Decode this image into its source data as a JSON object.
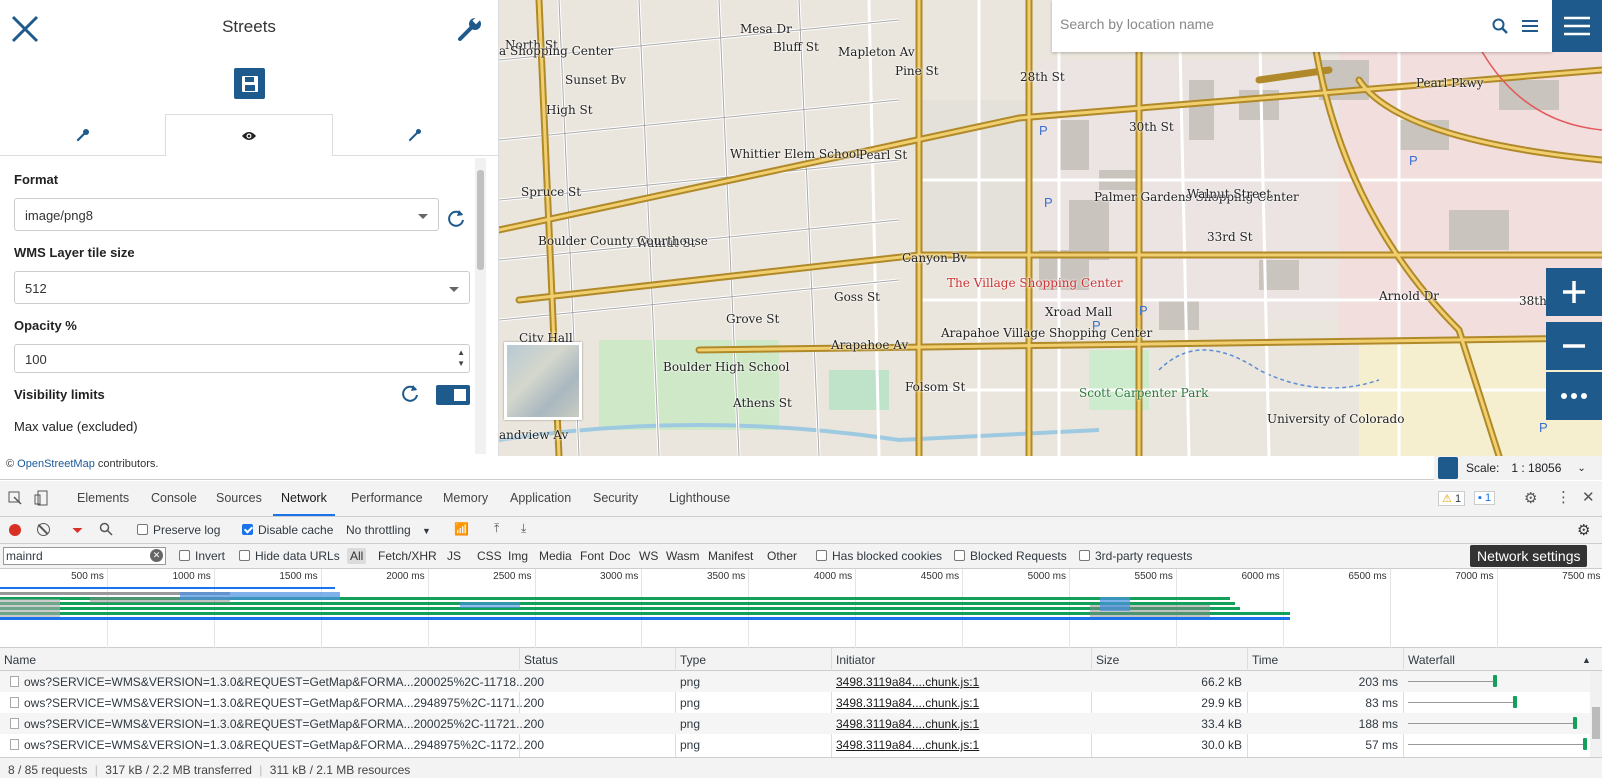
{
  "panel": {
    "title": "Streets",
    "tabs": [
      "settings-tab",
      "display-tab",
      "style-tab"
    ],
    "form": {
      "format_label": "Format",
      "format_value": "image/png8",
      "tile_label": "WMS Layer tile size",
      "tile_value": "512",
      "opacity_label": "Opacity %",
      "opacity_value": "100",
      "visibility_label": "Visibility limits",
      "max_label": "Max value (excluded)"
    }
  },
  "map": {
    "search_placeholder": "Search by location name",
    "labels": [
      {
        "text": "North St"
      },
      {
        "text": "Mesa Dr"
      },
      {
        "text": "Bluff St"
      },
      {
        "text": "Mapleton Av"
      },
      {
        "text": "Pine St"
      },
      {
        "text": "Pearl Pkwy"
      },
      {
        "text": "Sunset Bv"
      },
      {
        "text": "High St"
      },
      {
        "text": "a Shopping Center"
      },
      {
        "text": "Whittier Elem School"
      },
      {
        "text": "Pearl St"
      },
      {
        "text": "Spruce St"
      },
      {
        "text": "Walnut St"
      },
      {
        "text": "Boulder County Courthouse"
      },
      {
        "text": "Canyon Bv"
      },
      {
        "text": "Goss St"
      },
      {
        "text": "Grove St"
      },
      {
        "text": "City Hall"
      },
      {
        "text": "Boulder High School"
      },
      {
        "text": "Athens St"
      },
      {
        "text": "Arapahoe Av"
      },
      {
        "text": "The Village Shopping Center"
      },
      {
        "text": "Arapahoe Village Shopping Center"
      },
      {
        "text": "Xroad Mall"
      },
      {
        "text": "Palmer Gardens Shopping Center"
      },
      {
        "text": "Arnold Dr"
      },
      {
        "text": "38th St"
      },
      {
        "text": "University of Colorado"
      },
      {
        "text": "Folsom St"
      },
      {
        "text": "28th St"
      },
      {
        "text": "30th St"
      },
      {
        "text": "33rd St"
      },
      {
        "text": "Walnut Street"
      },
      {
        "text": "Scott Carpenter Park"
      },
      {
        "text": "andview Av"
      }
    ],
    "attribution_prefix": "©",
    "attribution_link": "OpenStreetMap",
    "attribution_suffix": "contributors.",
    "scale_label": "Scale:",
    "scale_value": "1 : 18056"
  },
  "devtools": {
    "tabs": [
      "Elements",
      "Console",
      "Sources",
      "Network",
      "Performance",
      "Memory",
      "Application",
      "Security",
      "Lighthouse"
    ],
    "active_tab": "Network",
    "warnings": "1",
    "messages": "1",
    "preserve_log": "Preserve log",
    "disable_cache": "Disable cache",
    "throttling": "No throttling",
    "filter_value": "mainrd",
    "invert": "Invert",
    "hide_data_urls": "Hide data URLs",
    "types": [
      "All",
      "Fetch/XHR",
      "JS",
      "CSS",
      "Img",
      "Media",
      "Font",
      "Doc",
      "WS",
      "Wasm",
      "Manifest",
      "Other"
    ],
    "has_blocked_cookies": "Has blocked cookies",
    "blocked_requests": "Blocked Requests",
    "third_party": "3rd-party requests",
    "tooltip": "Network settings",
    "ticks": [
      "500 ms",
      "1000 ms",
      "1500 ms",
      "2000 ms",
      "2500 ms",
      "3000 ms",
      "3500 ms",
      "4000 ms",
      "4500 ms",
      "5000 ms",
      "5500 ms",
      "6000 ms",
      "6500 ms",
      "7000 ms",
      "7500 ms"
    ],
    "columns": [
      "Name",
      "Status",
      "Type",
      "Initiator",
      "Size",
      "Time",
      "Waterfall"
    ],
    "rows": [
      {
        "name": "ows?SERVICE=WMS&VERSION=1.3.0&REQUEST=GetMap&FORMA...200025%2C-11718...",
        "status": "200",
        "type": "png",
        "initiator": "3498.3119a84....chunk.js:1",
        "size": "66.2 kB",
        "time": "203 ms"
      },
      {
        "name": "ows?SERVICE=WMS&VERSION=1.3.0&REQUEST=GetMap&FORMA...2948975%2C-1171...",
        "status": "200",
        "type": "png",
        "initiator": "3498.3119a84....chunk.js:1",
        "size": "29.9 kB",
        "time": "83 ms"
      },
      {
        "name": "ows?SERVICE=WMS&VERSION=1.3.0&REQUEST=GetMap&FORMA...200025%2C-11721...",
        "status": "200",
        "type": "png",
        "initiator": "3498.3119a84....chunk.js:1",
        "size": "33.4 kB",
        "time": "188 ms"
      },
      {
        "name": "ows?SERVICE=WMS&VERSION=1.3.0&REQUEST=GetMap&FORMA...2948975%2C-1172...",
        "status": "200",
        "type": "png",
        "initiator": "3498.3119a84....chunk.js:1",
        "size": "30.0 kB",
        "time": "57 ms"
      }
    ],
    "summary_requests": "8 / 85 requests",
    "summary_transferred": "317 kB / 2.2 MB transferred",
    "summary_resources": "311 kB / 2.1 MB resources"
  },
  "colors": {
    "accent": "#1f5a8c",
    "road": "#c8a33a",
    "green_bar": "#13a05a",
    "devtools_blue": "#1a73e8"
  }
}
